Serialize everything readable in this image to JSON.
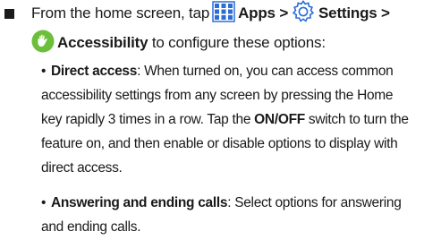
{
  "intro": {
    "from_text": "From the home screen, tap",
    "apps_label": "Apps >",
    "settings_label": "Settings >",
    "accessibility_label": "Accessibility",
    "configure_text": "to configure these options:"
  },
  "icons": {
    "bullet": "square-bullet",
    "apps": "apps-grid-icon",
    "settings": "settings-gear-icon",
    "accessibility": "accessibility-hand-icon"
  },
  "colors": {
    "apps_icon": "#2b6cd6",
    "settings_icon": "#2b6cd6",
    "accessibility_icon": "#6bbf3a"
  },
  "items": [
    {
      "title": "Direct access",
      "line1_rest": ": When turned on, you can access common",
      "line2": "accessibility settings from any screen by pressing the Home",
      "line3_pre": "key rapidly 3 times in a row. Tap the ",
      "line3_bold": "ON/OFF",
      "line3_post": " switch to turn the",
      "line4": "feature on, and then enable or disable options to display with",
      "line5": "direct access."
    },
    {
      "title": "Answering and ending calls",
      "line1_rest": ": Select options for answering",
      "line2": "and ending calls."
    }
  ]
}
